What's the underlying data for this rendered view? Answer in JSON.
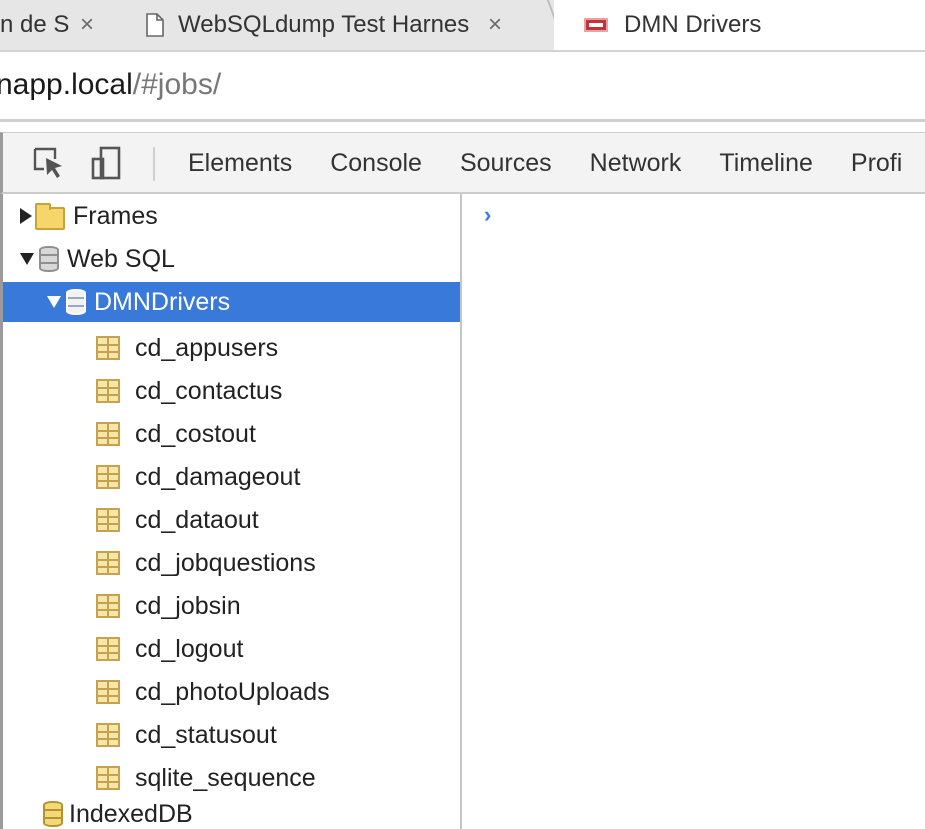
{
  "browser": {
    "tabs": [
      {
        "title": "n de S",
        "close": "×",
        "active": false
      },
      {
        "title": "WebSQLdump Test Harnes",
        "close": "×",
        "active": false
      },
      {
        "title": "DMN Drivers",
        "active": true
      }
    ],
    "url": {
      "host": "napp.local",
      "path": "/#jobs/"
    }
  },
  "devtools": {
    "toolbar": {
      "icons": [
        "inspect-element-icon",
        "device-mode-icon"
      ],
      "tabs": [
        "Elements",
        "Console",
        "Sources",
        "Network",
        "Timeline",
        "Profi"
      ]
    },
    "tree": {
      "frames": "Frames",
      "websql": "Web SQL",
      "database": "DMNDrivers",
      "tables": [
        "cd_appusers",
        "cd_contactus",
        "cd_costout",
        "cd_damageout",
        "cd_dataout",
        "cd_jobquestions",
        "cd_jobsin",
        "cd_logout",
        "cd_photoUploads",
        "cd_statusout",
        "sqlite_sequence"
      ],
      "indexeddb": "IndexedDB"
    },
    "console": {
      "prompt": "›"
    }
  },
  "colors": {
    "selection": "#3879d9",
    "prompt": "#367cf1"
  }
}
